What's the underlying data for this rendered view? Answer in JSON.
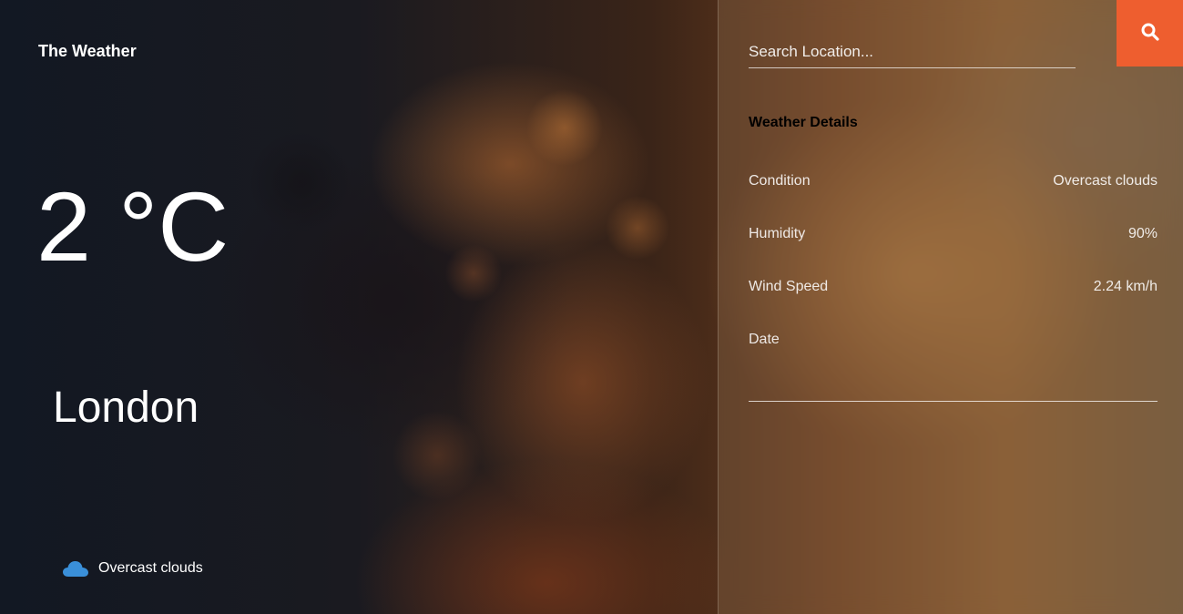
{
  "app": {
    "brand": "The Weather"
  },
  "current": {
    "temperature": "2 °C",
    "city": "London",
    "condition": "Overcast clouds",
    "condition_icon": "cloud-icon"
  },
  "search": {
    "placeholder": "Search Location...",
    "value": "",
    "button_icon": "search-icon"
  },
  "details": {
    "heading": "Weather Details",
    "rows": [
      {
        "label": "Condition",
        "value": "Overcast clouds"
      },
      {
        "label": "Humidity",
        "value": "90%"
      },
      {
        "label": "Wind Speed",
        "value": "2.24 km/h"
      },
      {
        "label": "Date",
        "value": ""
      }
    ]
  },
  "colors": {
    "accent": "#ee5e2f",
    "cloud_icon": "#3a8fd9",
    "text": "#ffffff"
  }
}
